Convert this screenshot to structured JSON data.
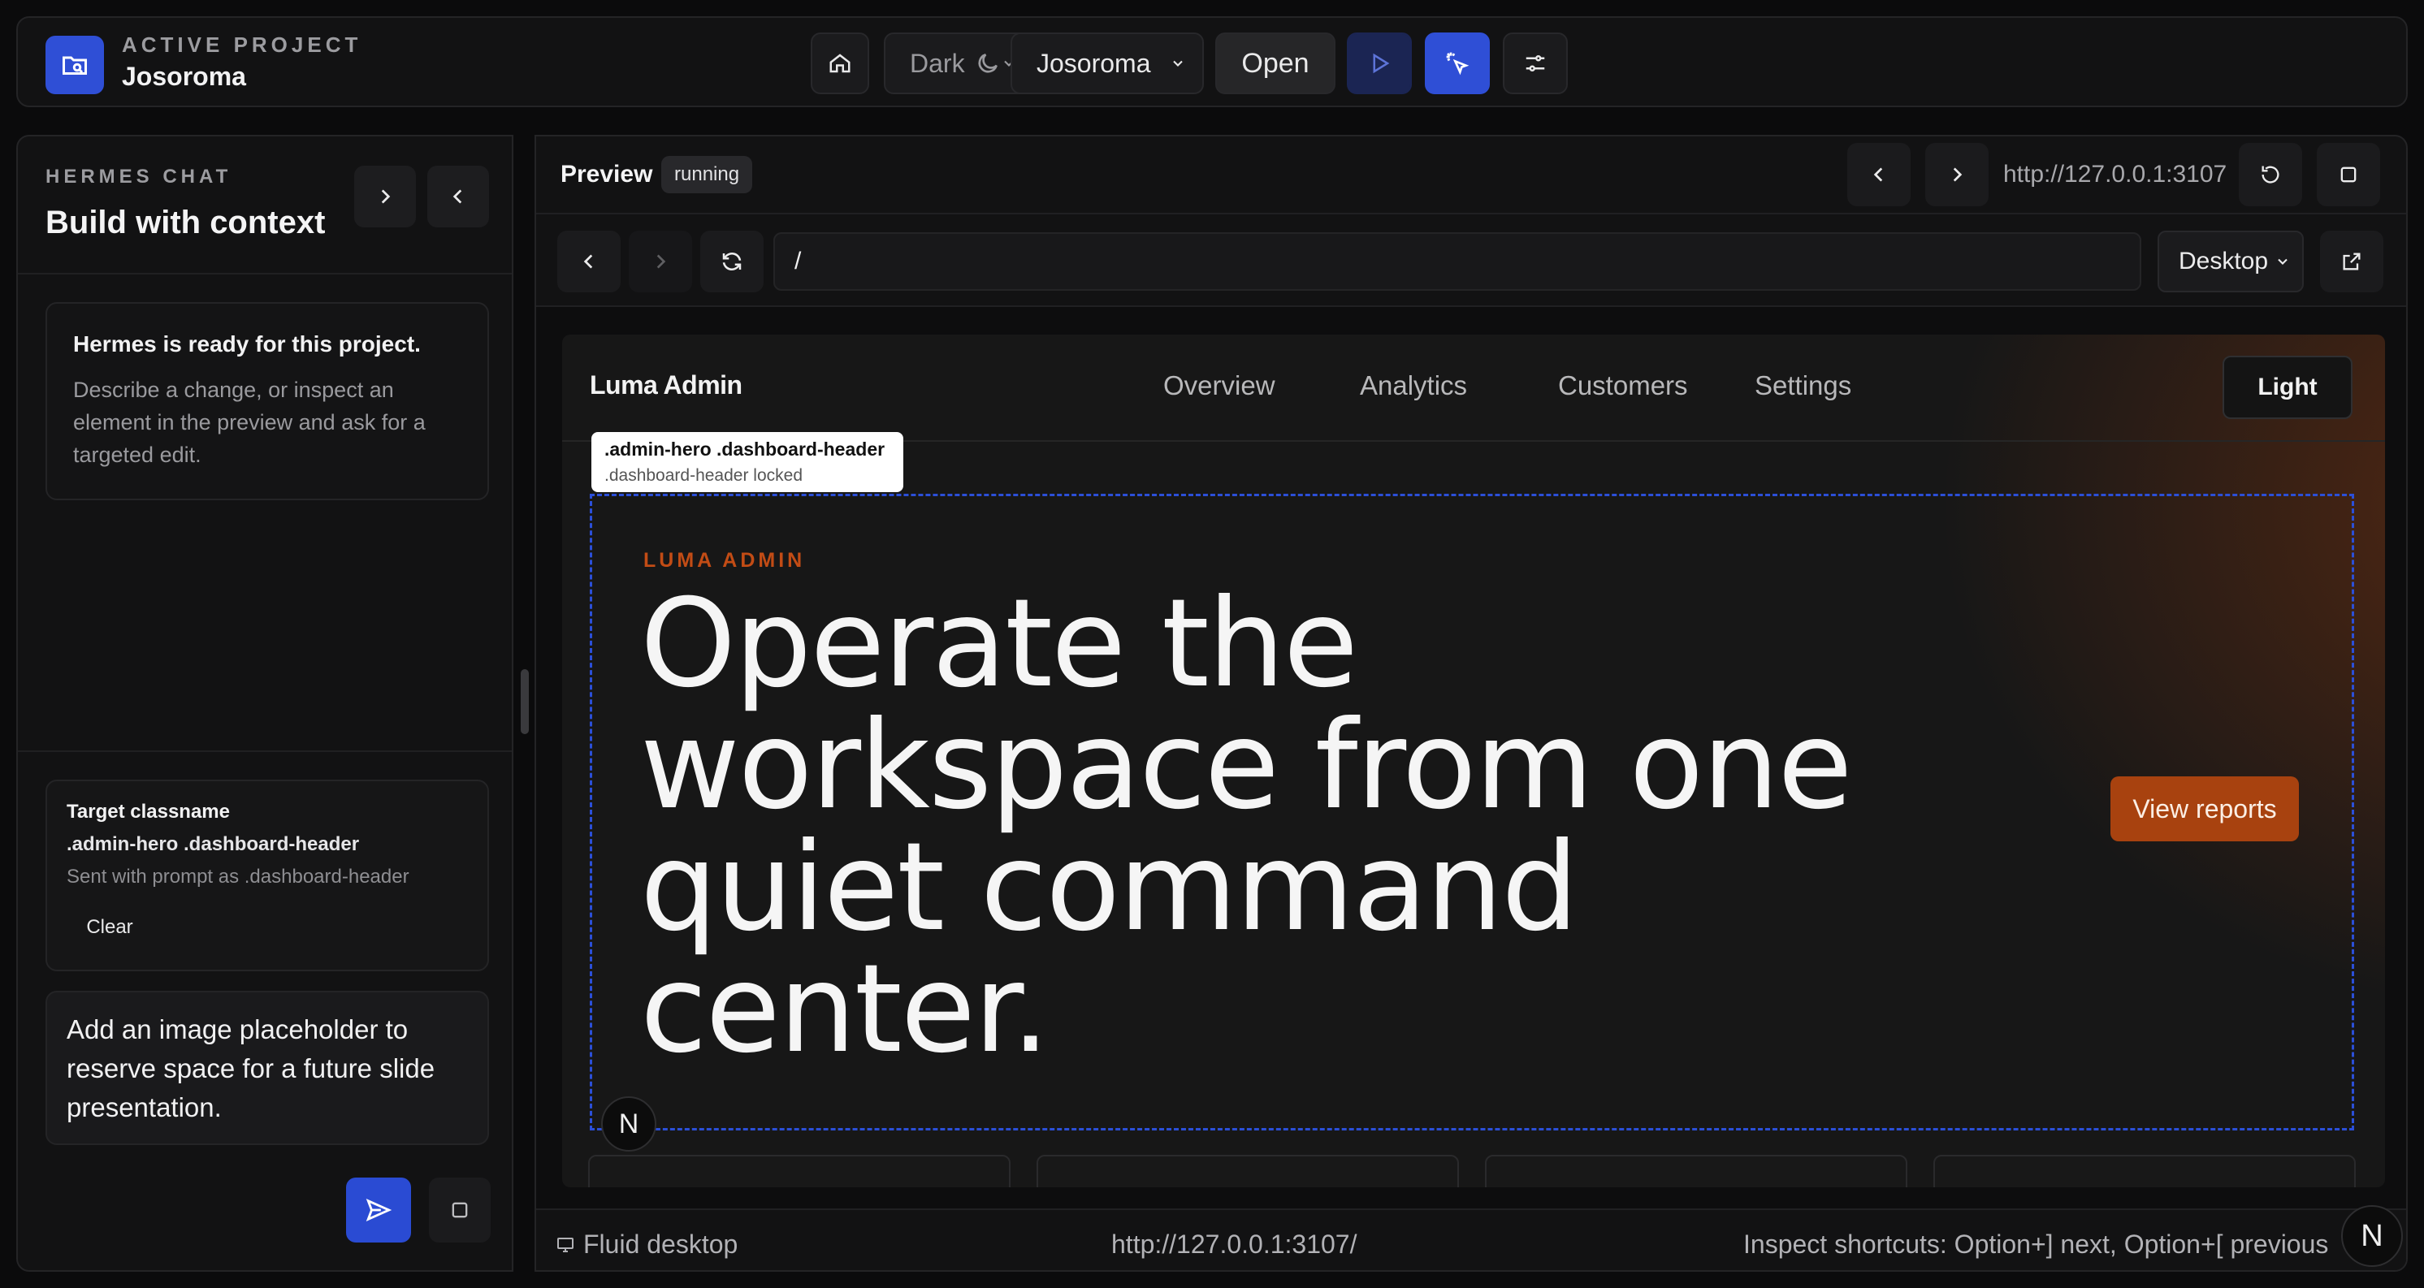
{
  "project": {
    "kicker": "ACTIVE PROJECT",
    "name": "Josoroma"
  },
  "topbar": {
    "theme_select": "Dark",
    "project_select": "Josoroma",
    "open_label": "Open"
  },
  "chat": {
    "kicker": "HERMES CHAT",
    "title": "Build with context",
    "ready_title": "Hermes is ready for this project.",
    "ready_desc": "Describe a change, or inspect an element in the preview and ask for a targeted edit.",
    "target_label": "Target classname",
    "target_class": ".admin-hero .dashboard-header",
    "target_note": "Sent with prompt as .dashboard-header",
    "clear_label": "Clear",
    "prompt_text": "Add an image placeholder to reserve space for a future slide presentation."
  },
  "preview": {
    "title": "Preview",
    "badge": "running",
    "url": "http://127.0.0.1:3107",
    "path": "/",
    "device": "Desktop"
  },
  "site": {
    "brand": "Luma Admin",
    "nav": [
      "Overview",
      "Analytics",
      "Customers",
      "Settings"
    ],
    "theme_button": "Light",
    "tooltip_title": ".admin-hero .dashboard-header",
    "tooltip_sub": ".dashboard-header locked",
    "hero_kicker": "LUMA ADMIN",
    "hero_title": "Operate the workspace from one quiet command center.",
    "cta": "View reports",
    "badge_letter": "N"
  },
  "status": {
    "left": "Fluid desktop",
    "center": "http://127.0.0.1:3107/",
    "right": "Inspect shortcuts: Option+] next, Option+[ previous",
    "badge_letter": "N"
  },
  "colors": {
    "accent_blue": "#2f4fd6",
    "accent_orange": "#a8420f",
    "selection_outline": "#2b4fd8"
  }
}
